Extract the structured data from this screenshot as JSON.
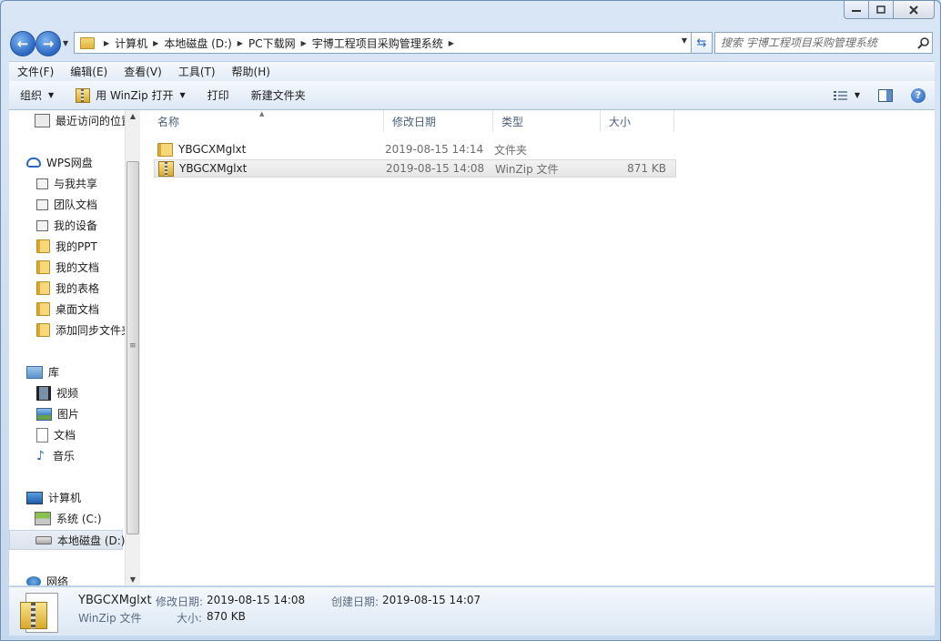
{
  "window": {
    "caption_buttons": [
      "minimize",
      "maximize",
      "close"
    ]
  },
  "address_bar": {
    "breadcrumbs": [
      "计算机",
      "本地磁盘 (D:)",
      "PC下载网",
      "宇博工程项目采购管理系统"
    ]
  },
  "search": {
    "placeholder": "搜索 宇博工程项目采购管理系统"
  },
  "menubar": {
    "items": [
      "文件(F)",
      "编辑(E)",
      "查看(V)",
      "工具(T)",
      "帮助(H)"
    ]
  },
  "toolbar": {
    "organize": "组织",
    "open_with": "用 WinZip 打开",
    "print": "打印",
    "new_folder": "新建文件夹"
  },
  "nav_pane": {
    "recent": "最近访问的位置",
    "wps_root": "WPS网盘",
    "wps_items": [
      "与我共享",
      "团队文档",
      "我的设备",
      "我的PPT",
      "我的文档",
      "我的表格",
      "桌面文档",
      "添加同步文件夹"
    ],
    "library_root": "库",
    "library_items": [
      "视频",
      "图片",
      "文档",
      "音乐"
    ],
    "computer_root": "计算机",
    "computer_items": [
      "系统 (C:)",
      "本地磁盘 (D:)"
    ],
    "network_root": "网络"
  },
  "file_list": {
    "columns": [
      "名称",
      "修改日期",
      "类型",
      "大小"
    ],
    "rows": [
      {
        "name": "YBGCXMglxt",
        "date": "2019-08-15 14:14",
        "type": "文件夹",
        "size": ""
      },
      {
        "name": "YBGCXMglxt",
        "date": "2019-08-15 14:08",
        "type": "WinZip 文件",
        "size": "871 KB"
      }
    ]
  },
  "details": {
    "name": "YBGCXMglxt",
    "type": "WinZip 文件",
    "modified_label": "修改日期:",
    "modified_value": "2019-08-15 14:08",
    "created_label": "创建日期:",
    "created_value": "2019-08-15 14:07",
    "size_label": "大小:",
    "size_value": "870 KB"
  },
  "colors": {
    "accent": "#2a66c2",
    "selection": "#e6e6e6",
    "chrome": "#c9dbee"
  }
}
